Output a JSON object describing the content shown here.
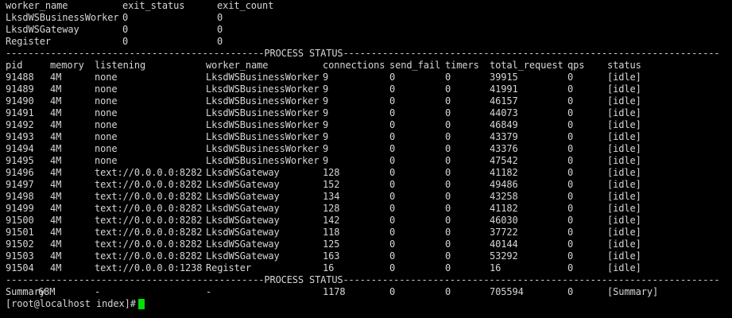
{
  "worker_table": {
    "headers": [
      "worker_name",
      "exit_status",
      "exit_count"
    ],
    "rows": [
      [
        "LksdWSBusinessWorker",
        "0",
        "0"
      ],
      [
        "LksdWSGateway",
        "0",
        "0"
      ],
      [
        "Register",
        "0",
        "0"
      ]
    ]
  },
  "separator_line": "----------------------------------------------PROCESS STATUS-------------------------------------------------------------------",
  "process_table": {
    "headers": [
      "pid",
      "memory",
      "listening",
      "worker_name",
      "connections",
      "send_fail",
      "timers",
      "total_request",
      "qps",
      "status"
    ],
    "rows": [
      [
        "91488",
        "4M",
        "none",
        "LksdWSBusinessWorker",
        "9",
        "0",
        "0",
        "39915",
        "0",
        "[idle]"
      ],
      [
        "91489",
        "4M",
        "none",
        "LksdWSBusinessWorker",
        "9",
        "0",
        "0",
        "41991",
        "0",
        "[idle]"
      ],
      [
        "91490",
        "4M",
        "none",
        "LksdWSBusinessWorker",
        "9",
        "0",
        "0",
        "46157",
        "0",
        "[idle]"
      ],
      [
        "91491",
        "4M",
        "none",
        "LksdWSBusinessWorker",
        "9",
        "0",
        "0",
        "44073",
        "0",
        "[idle]"
      ],
      [
        "91492",
        "4M",
        "none",
        "LksdWSBusinessWorker",
        "9",
        "0",
        "0",
        "46849",
        "0",
        "[idle]"
      ],
      [
        "91493",
        "4M",
        "none",
        "LksdWSBusinessWorker",
        "9",
        "0",
        "0",
        "43379",
        "0",
        "[idle]"
      ],
      [
        "91494",
        "4M",
        "none",
        "LksdWSBusinessWorker",
        "9",
        "0",
        "0",
        "43376",
        "0",
        "[idle]"
      ],
      [
        "91495",
        "4M",
        "none",
        "LksdWSBusinessWorker",
        "9",
        "0",
        "0",
        "47542",
        "0",
        "[idle]"
      ],
      [
        "91496",
        "4M",
        "text://0.0.0.0:8282",
        "LksdWSGateway",
        "128",
        "0",
        "0",
        "41182",
        "0",
        "[idle]"
      ],
      [
        "91497",
        "4M",
        "text://0.0.0.0:8282",
        "LksdWSGateway",
        "152",
        "0",
        "0",
        "49486",
        "0",
        "[idle]"
      ],
      [
        "91498",
        "4M",
        "text://0.0.0.0:8282",
        "LksdWSGateway",
        "134",
        "0",
        "0",
        "43258",
        "0",
        "[idle]"
      ],
      [
        "91499",
        "4M",
        "text://0.0.0.0:8282",
        "LksdWSGateway",
        "128",
        "0",
        "0",
        "41182",
        "0",
        "[idle]"
      ],
      [
        "91500",
        "4M",
        "text://0.0.0.0:8282",
        "LksdWSGateway",
        "142",
        "0",
        "0",
        "46030",
        "0",
        "[idle]"
      ],
      [
        "91501",
        "4M",
        "text://0.0.0.0:8282",
        "LksdWSGateway",
        "118",
        "0",
        "0",
        "37722",
        "0",
        "[idle]"
      ],
      [
        "91502",
        "4M",
        "text://0.0.0.0:8282",
        "LksdWSGateway",
        "125",
        "0",
        "0",
        "40144",
        "0",
        "[idle]"
      ],
      [
        "91503",
        "4M",
        "text://0.0.0.0:8282",
        "LksdWSGateway",
        "163",
        "0",
        "0",
        "53292",
        "0",
        "[idle]"
      ],
      [
        "91504",
        "4M",
        "text://0.0.0.0:1238",
        "Register",
        "16",
        "0",
        "0",
        "16",
        "0",
        "[idle]"
      ]
    ],
    "summary": [
      "Summary",
      "68M",
      "-",
      "-",
      "1178",
      "0",
      "0",
      "705594",
      "0",
      "[Summary]"
    ]
  },
  "prompt": "[root@localhost index]#",
  "colors": {
    "background": "#000000",
    "text": "#d6d6d6",
    "cursor": "#00e000"
  }
}
